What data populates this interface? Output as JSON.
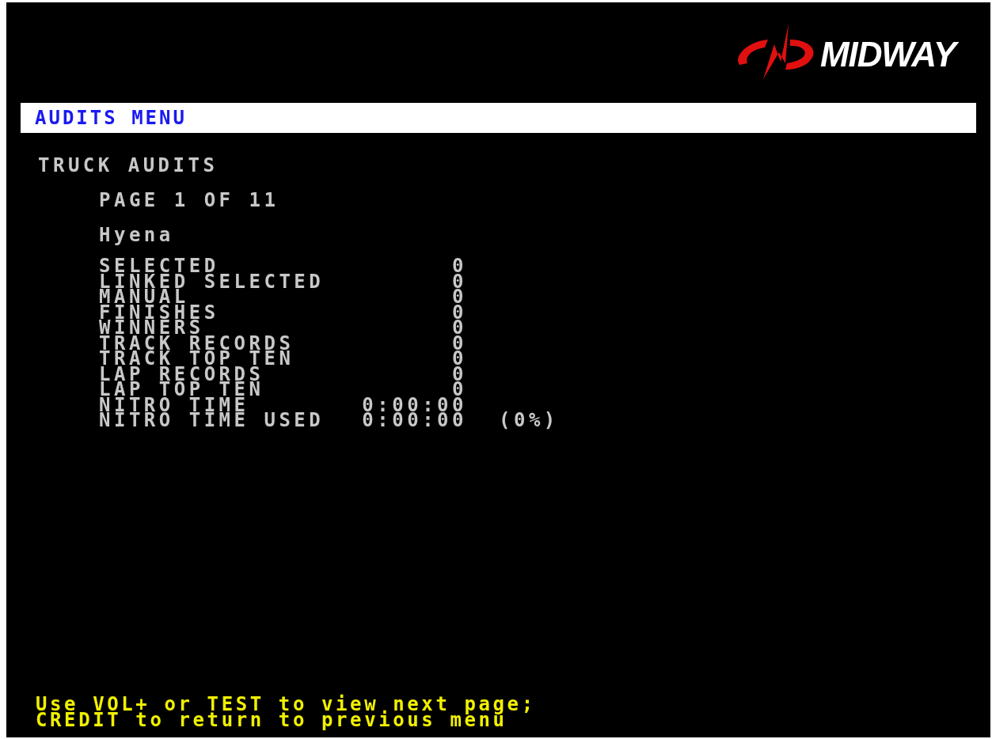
{
  "logo": {
    "text": "MIDWAY"
  },
  "menu_title": "AUDITS MENU",
  "section_title": "TRUCK AUDITS",
  "page_indicator": "PAGE 1 OF 11",
  "truck_name": "Hyena",
  "audits": [
    {
      "label": "SELECTED",
      "value": "0"
    },
    {
      "label": "LINKED SELECTED",
      "value": "0"
    },
    {
      "label": "MANUAL",
      "value": "0"
    },
    {
      "label": "FINISHES",
      "value": "0"
    },
    {
      "label": "WINNERS",
      "value": "0"
    },
    {
      "label": "TRACK RECORDS",
      "value": "0"
    },
    {
      "label": "TRACK TOP TEN",
      "value": "0"
    },
    {
      "label": "LAP RECORDS",
      "value": "0"
    },
    {
      "label": "LAP TOP TEN",
      "value": "0"
    },
    {
      "label": "NITRO TIME",
      "value": "0:00:00"
    },
    {
      "label": "NITRO TIME USED",
      "value": "0:00:00",
      "percent": "(0%)"
    }
  ],
  "instructions": [
    "Use VOL+ or TEST to view next page;",
    "CREDIT to return to previous menu"
  ]
}
